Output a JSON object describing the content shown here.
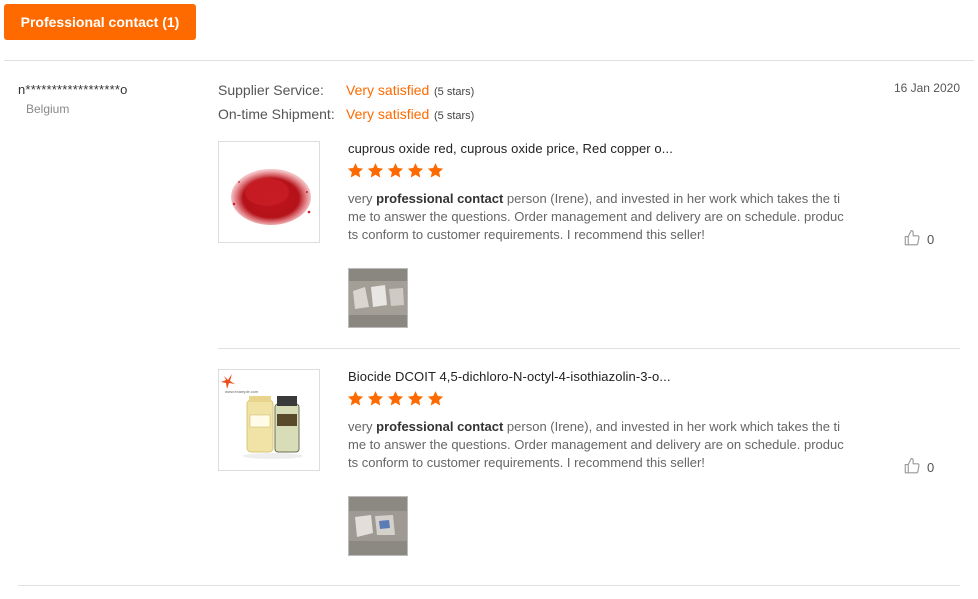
{
  "filter_tag": {
    "label": "Professional contact (1)",
    "color": "#ff6a00"
  },
  "review": {
    "buyer_name": "n******************o",
    "buyer_country": "Belgium",
    "date": "16 Jan 2020",
    "ratings": [
      {
        "label": "Supplier Service:",
        "value": "Very satisfied",
        "stars_text": "(5 stars)"
      },
      {
        "label": "On-time Shipment:",
        "value": "Very satisfied",
        "stars_text": "(5 stars)"
      }
    ],
    "products": [
      {
        "title": "cuprous oxide red, cuprous oxide price, Red copper o...",
        "rating": 5,
        "text_pre": "very ",
        "text_bold": "professional contact",
        "text_post": " person (Irene), and invested in her work which takes the time to answer the questions. Order management and delivery are on schedule. products conform to customer requirements. I recommend this seller!",
        "likes": "0",
        "thumb_icon": "red-powder-image",
        "attachment_icon": "packaging-photo"
      },
      {
        "title": "Biocide DCOIT 4,5-dichloro-N-octyl-4-isothiazolin-3-o...",
        "rating": 5,
        "text_pre": "very ",
        "text_bold": "professional contact",
        "text_post": " person (Irene), and invested in her work which takes the time to answer the questions. Order management and delivery are on schedule. products conform to customer requirements. I recommend this seller!",
        "likes": "0",
        "thumb_icon": "chemical-bottles-image",
        "attachment_icon": "packaging-photo"
      }
    ]
  },
  "colors": {
    "accent": "#ff6a00",
    "star": "#ff6a00",
    "divider": "#e0e0e0"
  }
}
